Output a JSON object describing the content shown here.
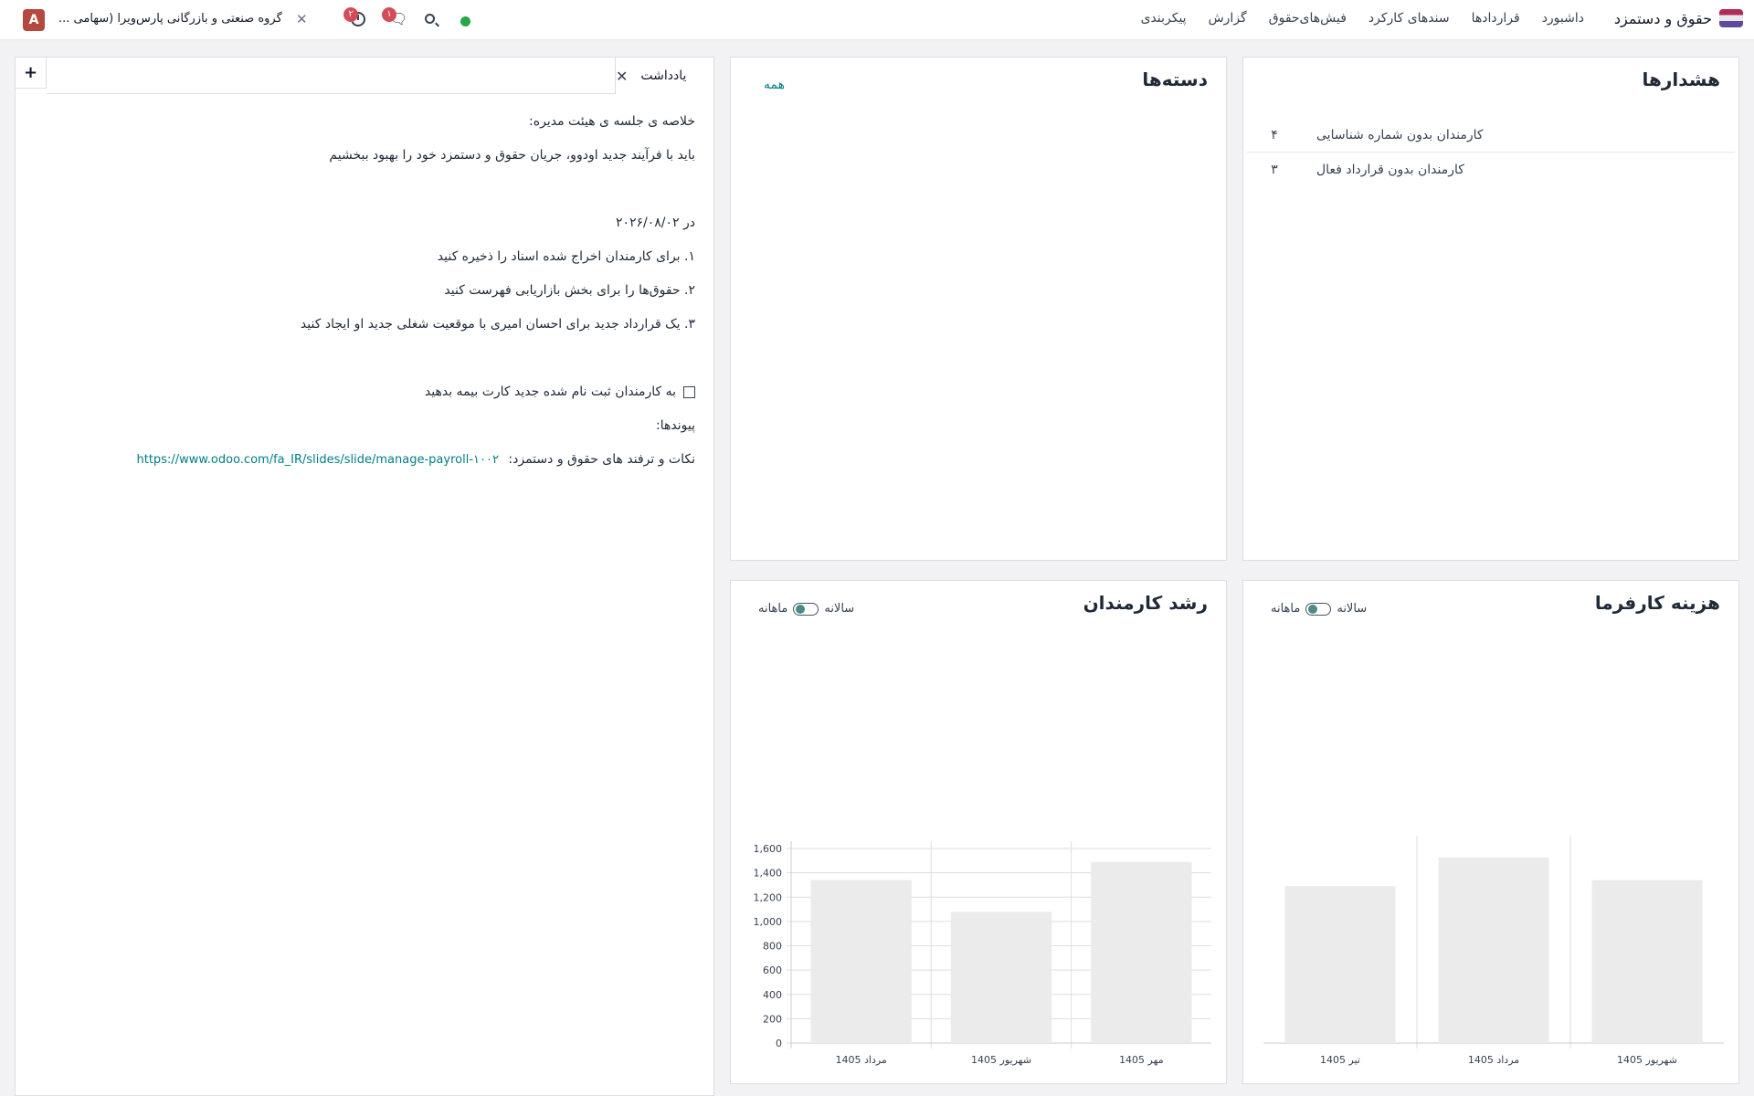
{
  "navbar": {
    "app_title": "حقوق و دستمزد",
    "menu": [
      "داشبورد",
      "قراردادها",
      "سندهای کارکرد",
      "فیش‌های‌حقوق",
      "گزارش",
      "پیکربندی"
    ],
    "company": "گروه صنعتی و بازرگانی پارس‌ویرا (سهامی ...",
    "avatar_letter": "A",
    "activity_badge": "۲",
    "chat_badge": "۱",
    "presence_color": "#28a745"
  },
  "warnings": {
    "title": "هشدارها",
    "rows": [
      {
        "count": "۴",
        "label": "کارمندان بدون شماره شناسایی"
      },
      {
        "count": "۳",
        "label": "کارمندان بدون قرارداد فعال"
      }
    ]
  },
  "categories": {
    "title": "دسته‌ها",
    "all_link": "همه"
  },
  "note": {
    "tab_label": "یادداشت",
    "lines": [
      "خلاصه ی جلسه ی هیئت مدیره:",
      "باید با فرآیند جدید اودوو، جریان حقوق و دستمزد خود را بهبود ببخشیم",
      "",
      "در ۲۰۲۶/۰۸/۰۲",
      "۱. برای کارمندان اخراج شده اسناد را ذخیره کنید",
      "۲. حقوق‌ها را برای بخش بازاریابی فهرست کنید",
      "۳. یک قرارداد جدید برای احسان امیری با موقعیت شغلی جدید او ایجاد کنید",
      ""
    ],
    "checklist_item": "به کارمندان ثبت نام شده جدید کارت بیمه بدهید",
    "links_heading": "پیوندها:",
    "tips_label": "نکات و ترفند های حقوق و دستمزد:",
    "tips_url": "https://www.odoo.com/fa_IR/slides/slide/manage-payroll-۱۰۰۲"
  },
  "toggle": {
    "yearly": "سالانه",
    "monthly": "ماهانه"
  },
  "chart_data": [
    {
      "id": "employee-growth",
      "type": "bar",
      "title": "رشد کارمندان",
      "categories": [
        "مرداد 1405",
        "شهریور 1405",
        "مهر 1405"
      ],
      "values": [
        1340,
        1080,
        1490
      ],
      "ylim": [
        0,
        1600
      ],
      "yticks": [
        "0",
        "200",
        "400",
        "600",
        "800",
        "1,000",
        "1,200",
        "1,400",
        "1,600"
      ],
      "grid": true,
      "bar_color": "#ebebeb"
    },
    {
      "id": "employer-cost",
      "type": "bar",
      "title": "هزینه کارفرما",
      "categories": [
        "تیر 1405",
        "مرداد 1405",
        "شهریور 1405"
      ],
      "values": [
        1310,
        1550,
        1360
      ],
      "ylim": [
        0,
        1670
      ],
      "grid": false,
      "bar_color": "#ebebeb"
    }
  ]
}
